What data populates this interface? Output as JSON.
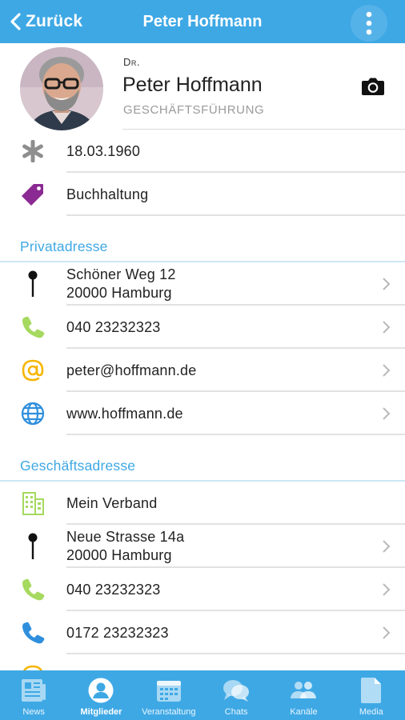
{
  "topbar": {
    "back_label": "Zurück",
    "title": "Peter Hoffmann",
    "more_icon": "more-vertical-icon"
  },
  "profile": {
    "title": "Dr.",
    "name": "Peter Hoffmann",
    "role": "GESCHÄFTSFÜHRUNG",
    "camera_icon": "camera-icon"
  },
  "details": {
    "birthday": "18.03.1960",
    "department": "Buchhaltung"
  },
  "private": {
    "heading": "Privatadresse",
    "street": "Schöner Weg 12",
    "city": "20000 Hamburg",
    "phone": "040 23232323",
    "email": "peter@hoffmann.de",
    "web": "www.hoffmann.de"
  },
  "business": {
    "heading": "Geschäftsadresse",
    "company": "Mein Verband",
    "street": "Neue Strasse 14a",
    "city": "20000 Hamburg",
    "phone": "040 23232323",
    "mobile": "0172 23232323"
  },
  "colors": {
    "accent": "#3ea8e5",
    "phone_green": "#a6d95f",
    "mobile_blue": "#2f8fdd",
    "email_orange": "#f7b500",
    "tag_purple": "#8b2a93",
    "asterisk_gray": "#8e8e8e"
  },
  "tabs": [
    {
      "label": "News",
      "icon": "newspaper-icon",
      "active": false
    },
    {
      "label": "Mitglieder",
      "icon": "person-icon",
      "active": true
    },
    {
      "label": "Veranstaltung",
      "icon": "calendar-icon",
      "active": false
    },
    {
      "label": "Chats",
      "icon": "chat-bubbles-icon",
      "active": false
    },
    {
      "label": "Kanäle",
      "icon": "group-icon",
      "active": false
    },
    {
      "label": "Media",
      "icon": "document-icon",
      "active": false
    }
  ]
}
